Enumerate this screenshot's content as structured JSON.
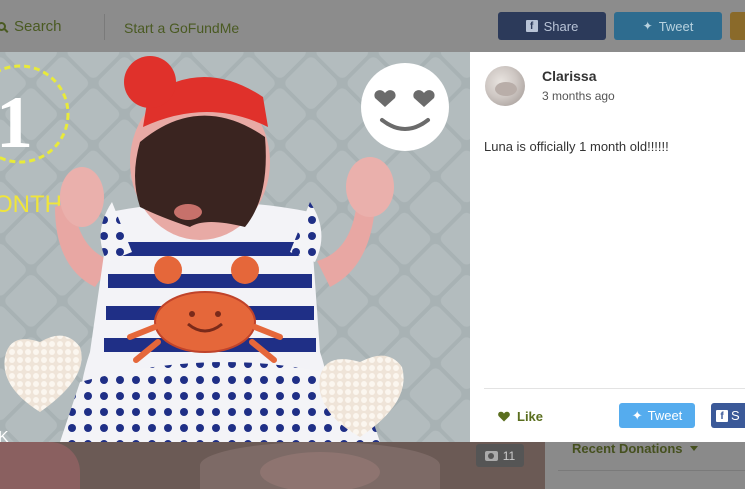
{
  "header": {
    "search_label": "Search",
    "start_label": "Start a GoFundMe",
    "share_label": "Share",
    "tweet_label": "Tweet"
  },
  "photo": {
    "badge_number": "1",
    "badge_text": "ONTH",
    "corner_text": "K",
    "photo_count": "11"
  },
  "post": {
    "author": "Clarissa",
    "time": "3 months ago",
    "text": "Luna is officially 1 month old!!!!!!",
    "like_label": "Like",
    "tweet_label": "Tweet",
    "share_label": "S"
  },
  "sidebar": {
    "recent_donations_label": "Recent Donations"
  },
  "colors": {
    "facebook": "#3b5998",
    "twitter": "#55acee",
    "like_green": "#5a6e1e"
  }
}
